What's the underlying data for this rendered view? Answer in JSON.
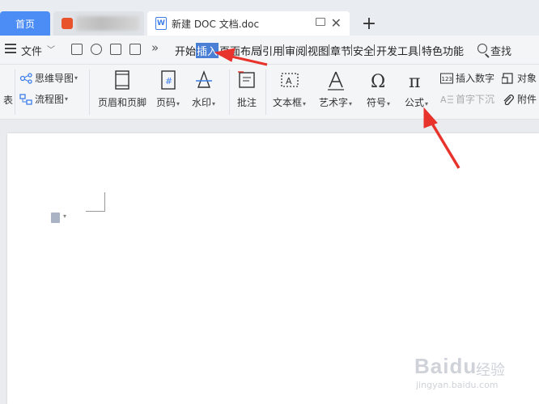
{
  "tabs": {
    "home": "首页",
    "document": "新建 DOC 文档.doc",
    "doc_icon": "W"
  },
  "menu": {
    "file": "文件",
    "more": "»",
    "items": [
      "开始",
      "插入",
      "页面布局",
      "引用",
      "审阅",
      "视图",
      "章节",
      "安全",
      "开发工具",
      "特色功能"
    ],
    "active": "插入",
    "search": "查找"
  },
  "ribbon": {
    "left_cut": "表",
    "mindmap": "思维导图",
    "flowchart": "流程图",
    "header_footer": "页眉和页脚",
    "page_number": "页码",
    "watermark": "水印",
    "comment": "批注",
    "textbox": "文本框",
    "wordart": "艺术字",
    "symbol": "符号",
    "formula": "公式",
    "insert_number": "插入数字",
    "dropcap": "首字下沉",
    "object": "对象",
    "attachment": "附件"
  },
  "watermark": {
    "brand": "Baidu",
    "sub": "经验",
    "url": "jingyan.baidu.com"
  },
  "colors": {
    "accent": "#4c8cf5",
    "active_menu": "#4a7fd6",
    "arrow": "#e8322c"
  }
}
